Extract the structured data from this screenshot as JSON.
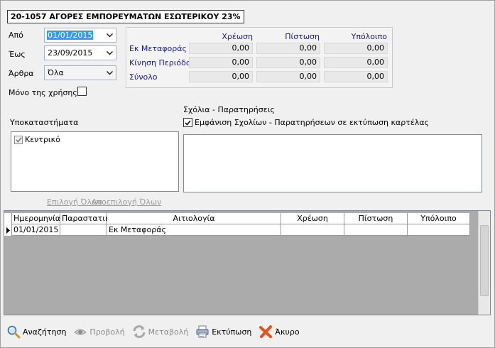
{
  "header": {
    "account_title": "20-1057 ΑΓΟΡΕΣ ΕΜΠΟΡΕΥΜΑΤΩΝ ΕΣΩΤΕΡΙΚΟΥ 23%"
  },
  "filters": {
    "from_label": "Από",
    "from_value": "01/01/2015",
    "to_label": "Έως",
    "to_value": "23/09/2015",
    "entries_label": "Άρθρα",
    "entries_value": "Όλα",
    "year_only_label": "Μόνο της χρήσης"
  },
  "summary": {
    "headers": {
      "debit": "Χρέωση",
      "credit": "Πίστωση",
      "balance": "Υπόλοιπο"
    },
    "rows": [
      {
        "label": "Εκ Μεταφοράς",
        "debit": "0,00",
        "credit": "0,00",
        "balance": "0,00"
      },
      {
        "label": "Κίνηση Περιόδου",
        "debit": "0,00",
        "credit": "0,00",
        "balance": "0,00"
      },
      {
        "label": "Σύνολο",
        "debit": "0,00",
        "credit": "0,00",
        "balance": "0,00"
      }
    ]
  },
  "branches": {
    "label": "Υποκαταστήματα",
    "items": [
      {
        "label": "Κεντρικό",
        "checked": true
      }
    ],
    "select_all": "Επιλογή Όλων",
    "deselect_all": "Αποεπιλογή Όλων"
  },
  "comments": {
    "label": "Σχόλια - Παρατηρήσεις",
    "show_in_print_label": "Εμφάνιση Σχολίων - Παρατηρήσεων σε εκτύπωση καρτέλας",
    "show_in_print_checked": true
  },
  "grid": {
    "columns": [
      "Ημερομηνία",
      "Παραστατικό",
      "Αιτιολογία",
      "Χρέωση",
      "Πίστωση",
      "Υπόλοιπο"
    ],
    "rows": [
      {
        "date": "01/01/2015",
        "document": "",
        "reason": "Εκ Μεταφοράς",
        "debit": "",
        "credit": "",
        "balance": ""
      }
    ]
  },
  "toolbar": {
    "search": "Αναζήτηση",
    "view": "Προβολή",
    "edit": "Μεταβολή",
    "print": "Εκτύπωση",
    "cancel": "Άκυρο"
  },
  "icons": {
    "dropdown": "chevron-down-icon",
    "search": "magnifier-icon",
    "view": "eye-icon",
    "edit": "refresh-icon",
    "print": "printer-icon",
    "cancel": "x-icon",
    "row_indicator": "triangle-right-icon"
  },
  "colors": {
    "label_blue": "#1a1a8c",
    "selection": "#3399ff",
    "cancel_red": "#e8501a"
  }
}
